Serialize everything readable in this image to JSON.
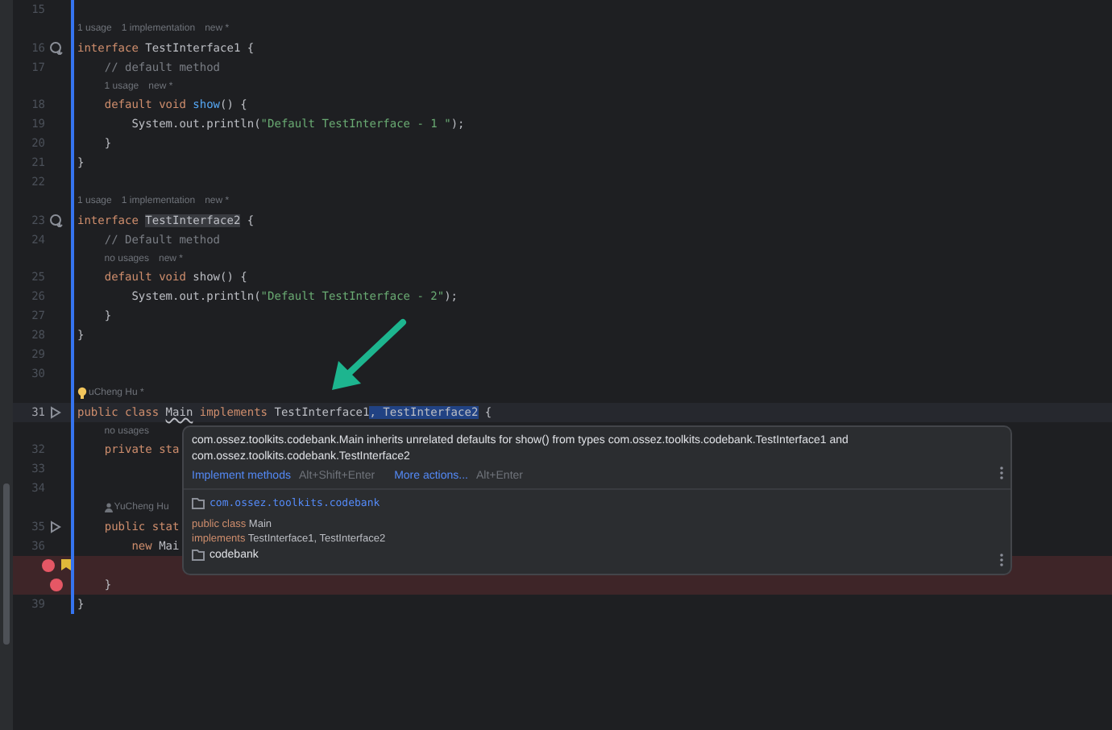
{
  "editor": {
    "rows": [
      {
        "kind": "code",
        "number": "15",
        "tokens": []
      },
      {
        "kind": "hint",
        "parts": [
          "1 usage",
          "1 implementation",
          "new *"
        ]
      },
      {
        "kind": "code",
        "number": "16",
        "gutter": {
          "kind": "implemented"
        },
        "tokens": [
          {
            "text": "interface",
            "kind": "keyword"
          },
          {
            "text": " TestInterface1 {",
            "kind": "plain"
          }
        ]
      },
      {
        "kind": "code",
        "number": "17",
        "tokens": [
          {
            "text": "    // default method",
            "kind": "comment"
          }
        ]
      },
      {
        "kind": "hint",
        "parts": [
          "1 usage",
          "new *"
        ]
      },
      {
        "kind": "code",
        "number": "18",
        "tokens": [
          {
            "text": "    default void ",
            "kind": "keyword"
          },
          {
            "text": "show",
            "kind": "method"
          },
          {
            "text": "() {",
            "kind": "plain"
          }
        ]
      },
      {
        "kind": "code",
        "number": "19",
        "tokens": [
          {
            "text": "        System.out.println(",
            "kind": "plain"
          },
          {
            "text": "\"Default TestInterface - 1 \"",
            "kind": "string"
          },
          {
            "text": ");",
            "kind": "plain"
          }
        ]
      },
      {
        "kind": "code",
        "number": "20",
        "tokens": [
          {
            "text": "    }",
            "kind": "plain"
          }
        ]
      },
      {
        "kind": "code",
        "number": "21",
        "tokens": [
          {
            "text": "}",
            "kind": "plain"
          }
        ]
      },
      {
        "kind": "code",
        "number": "22",
        "tokens": []
      },
      {
        "kind": "hint",
        "parts": [
          "1 usage",
          "1 implementation",
          "new *"
        ]
      },
      {
        "kind": "code",
        "number": "23",
        "gutter": {
          "kind": "implemented"
        },
        "tokens": [
          {
            "text": "interface ",
            "kind": "keyword"
          },
          {
            "text": "TestInterface2",
            "kind": "reference"
          },
          {
            "text": " {",
            "kind": "plain"
          }
        ]
      },
      {
        "kind": "code",
        "number": "24",
        "tokens": [
          {
            "text": "    // Default method",
            "kind": "comment"
          }
        ]
      },
      {
        "kind": "hint",
        "parts": [
          "no usages",
          "new *"
        ]
      },
      {
        "kind": "code",
        "number": "25",
        "tokens": [
          {
            "text": "    default void",
            "kind": "keyword"
          },
          {
            "text": " show() {",
            "kind": "plain"
          }
        ]
      },
      {
        "kind": "code",
        "number": "26",
        "tokens": [
          {
            "text": "        System.out.println(",
            "kind": "plain"
          },
          {
            "text": "\"Default TestInterface - 2\"",
            "kind": "string"
          },
          {
            "text": ");",
            "kind": "plain"
          }
        ]
      },
      {
        "kind": "code",
        "number": "27",
        "tokens": [
          {
            "text": "    }",
            "kind": "plain"
          }
        ]
      },
      {
        "kind": "code",
        "number": "28",
        "tokens": [
          {
            "text": "}",
            "kind": "plain"
          }
        ]
      },
      {
        "kind": "code",
        "number": "29",
        "tokens": []
      },
      {
        "kind": "code",
        "number": "30",
        "tokens": []
      },
      {
        "kind": "author",
        "bulb": true,
        "text": "uCheng Hu *"
      },
      {
        "kind": "code",
        "number": "31",
        "gutter": {
          "kind": "run"
        },
        "current": true,
        "tokens": [
          {
            "text": "public class ",
            "kind": "keyword"
          },
          {
            "text": "Main",
            "kind": "error"
          },
          {
            "text": " implements",
            "kind": "keyword"
          },
          {
            "text": " TestInterface1",
            "kind": "plain"
          },
          {
            "text": ", TestInterface2",
            "kind": "selection"
          },
          {
            "text": " {",
            "kind": "plain"
          }
        ]
      },
      {
        "kind": "hint",
        "parts": [
          "no usages"
        ]
      },
      {
        "kind": "code",
        "number": "32",
        "tokens": [
          {
            "text": "    private sta",
            "kind": "keyword"
          }
        ]
      },
      {
        "kind": "code",
        "number": "33",
        "tokens": []
      },
      {
        "kind": "code",
        "number": "34",
        "tokens": []
      },
      {
        "kind": "author",
        "bulb": false,
        "text": "YuCheng Hu"
      },
      {
        "kind": "code",
        "number": "35",
        "gutter": {
          "kind": "run"
        },
        "tokens": [
          {
            "text": "    public stat",
            "kind": "keyword"
          }
        ]
      },
      {
        "kind": "code",
        "number": "36",
        "tokens": [
          {
            "text": "        new ",
            "kind": "keyword"
          },
          {
            "text": "Mai",
            "kind": "plain"
          }
        ]
      },
      {
        "kind": "code",
        "gutter": {
          "kind": "breakpoint-bookmark"
        },
        "tokens": []
      },
      {
        "kind": "code",
        "gutter": {
          "kind": "breakpoint"
        },
        "tokens": [
          {
            "text": "    }",
            "kind": "plain"
          }
        ]
      },
      {
        "kind": "code",
        "number": "39",
        "tokens": [
          {
            "text": "}",
            "kind": "plain"
          }
        ]
      }
    ]
  },
  "popup": {
    "message": "com.ossez.toolkits.codebank.Main inherits unrelated defaults for show() from types com.ossez.toolkits.codebank.TestInterface1 and com.ossez.toolkits.codebank.TestInterface2",
    "actions": [
      {
        "label": "Implement methods",
        "shortcut": "Alt+Shift+Enter"
      },
      {
        "label": "More actions...",
        "shortcut": "Alt+Enter"
      }
    ],
    "package": "com.ossez.toolkits.codebank",
    "declaration": [
      [
        {
          "text": "public class",
          "kind": "keyword"
        },
        {
          "text": " Main",
          "kind": "plain"
        }
      ],
      [
        {
          "text": "implements",
          "kind": "keyword"
        },
        {
          "text": " TestInterface1, TestInterface2",
          "kind": "plain"
        }
      ]
    ],
    "module": "codebank"
  }
}
